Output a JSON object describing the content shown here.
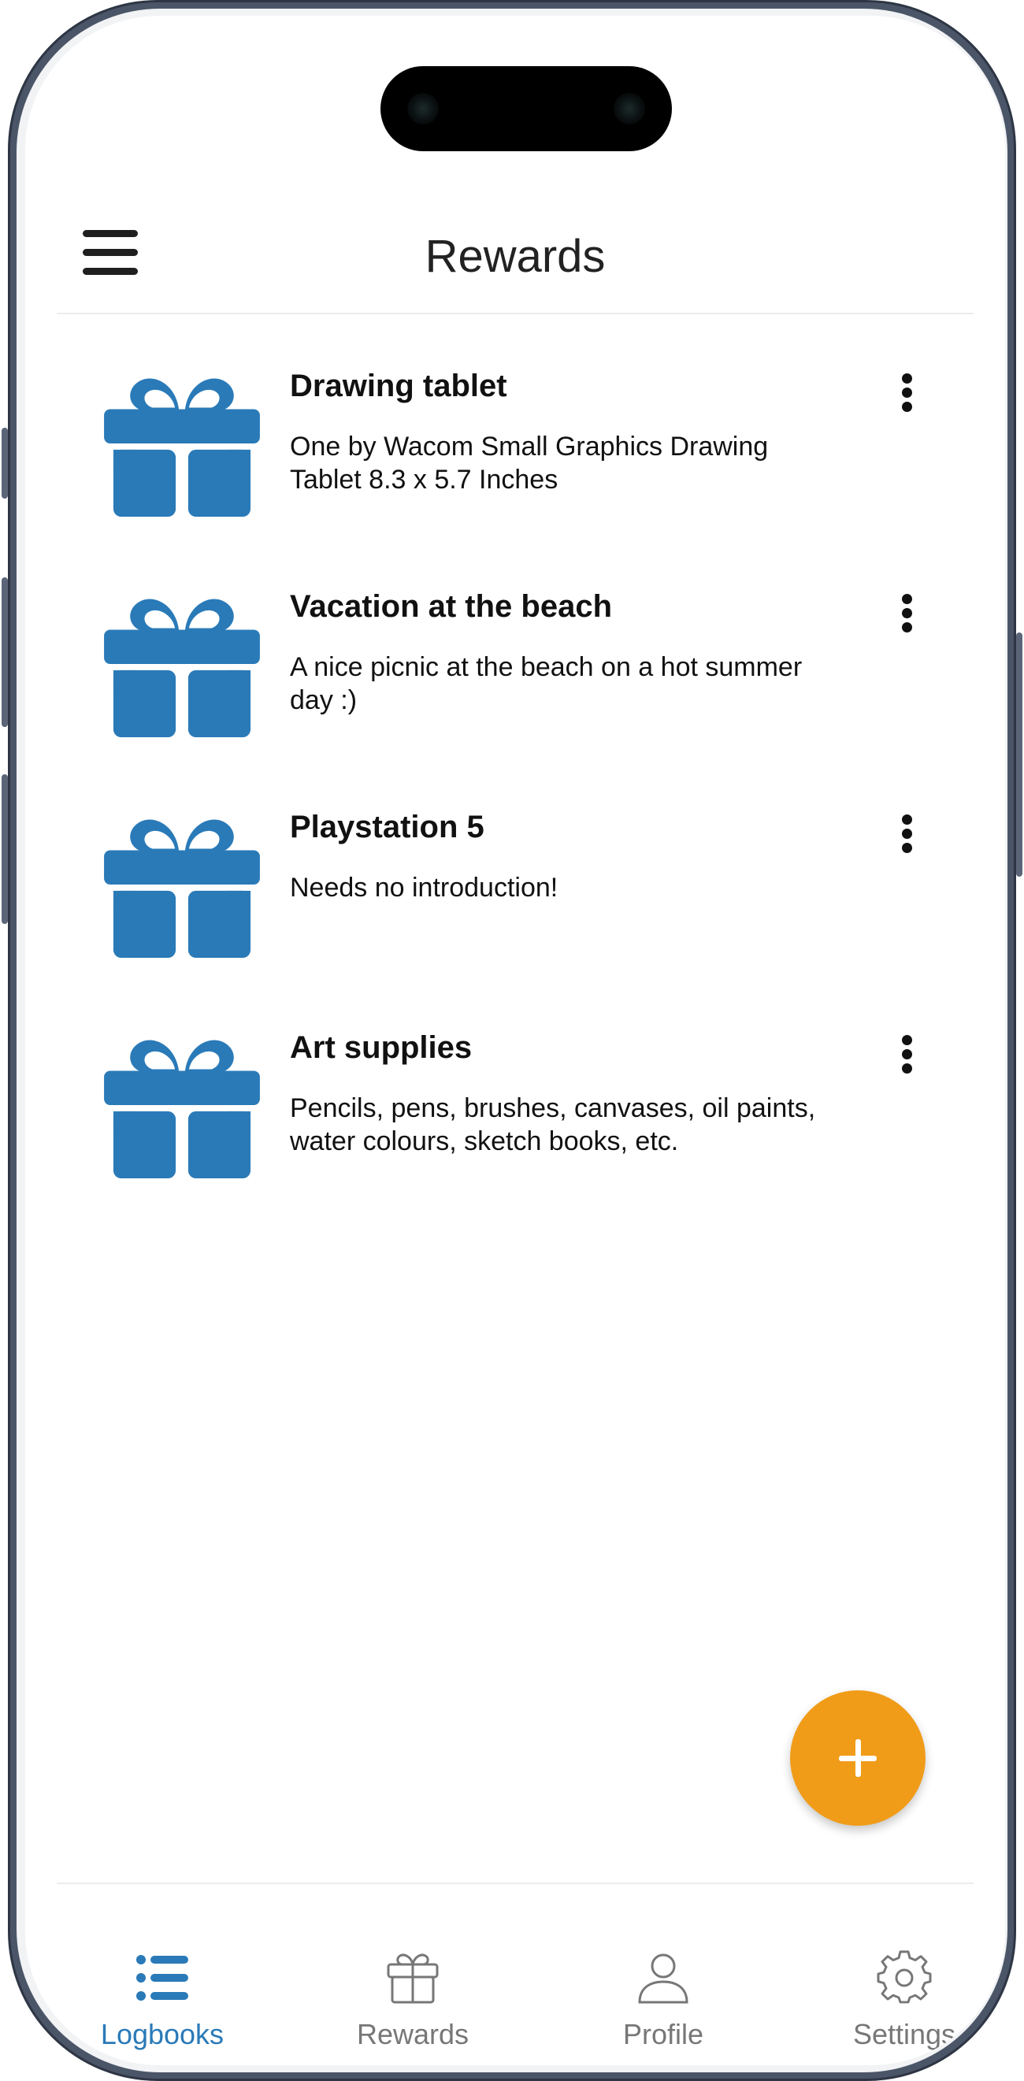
{
  "header": {
    "title": "Rewards"
  },
  "rewards": [
    {
      "title": "Drawing tablet",
      "description": "One by Wacom Small Graphics Drawing Tablet 8.3 x 5.7 Inches"
    },
    {
      "title": "Vacation at the beach",
      "description": "A nice picnic at the beach on a hot summer day :)"
    },
    {
      "title": "Playstation 5",
      "description": "Needs no introduction!"
    },
    {
      "title": "Art supplies",
      "description": "Pencils, pens, brushes, canvases, oil paints, water colours, sketch books, etc."
    }
  ],
  "icons": {
    "reward_item_icon": "gift-icon",
    "more_options_icon": "more-vertical-icon",
    "menu_icon": "hamburger-menu-icon",
    "fab_icon": "plus-icon"
  },
  "tabbar": {
    "tabs": [
      {
        "label": "Logbooks",
        "icon": "list-icon",
        "active": true
      },
      {
        "label": "Rewards",
        "icon": "gift-icon",
        "active": false
      },
      {
        "label": "Profile",
        "icon": "user-icon",
        "active": false
      },
      {
        "label": "Settings",
        "icon": "gear-icon",
        "active": false
      }
    ]
  },
  "colors": {
    "accent_blue": "#2a7ab8",
    "fab_orange": "#f09c19",
    "inactive_gray": "#777777",
    "text_dark": "#111111"
  }
}
